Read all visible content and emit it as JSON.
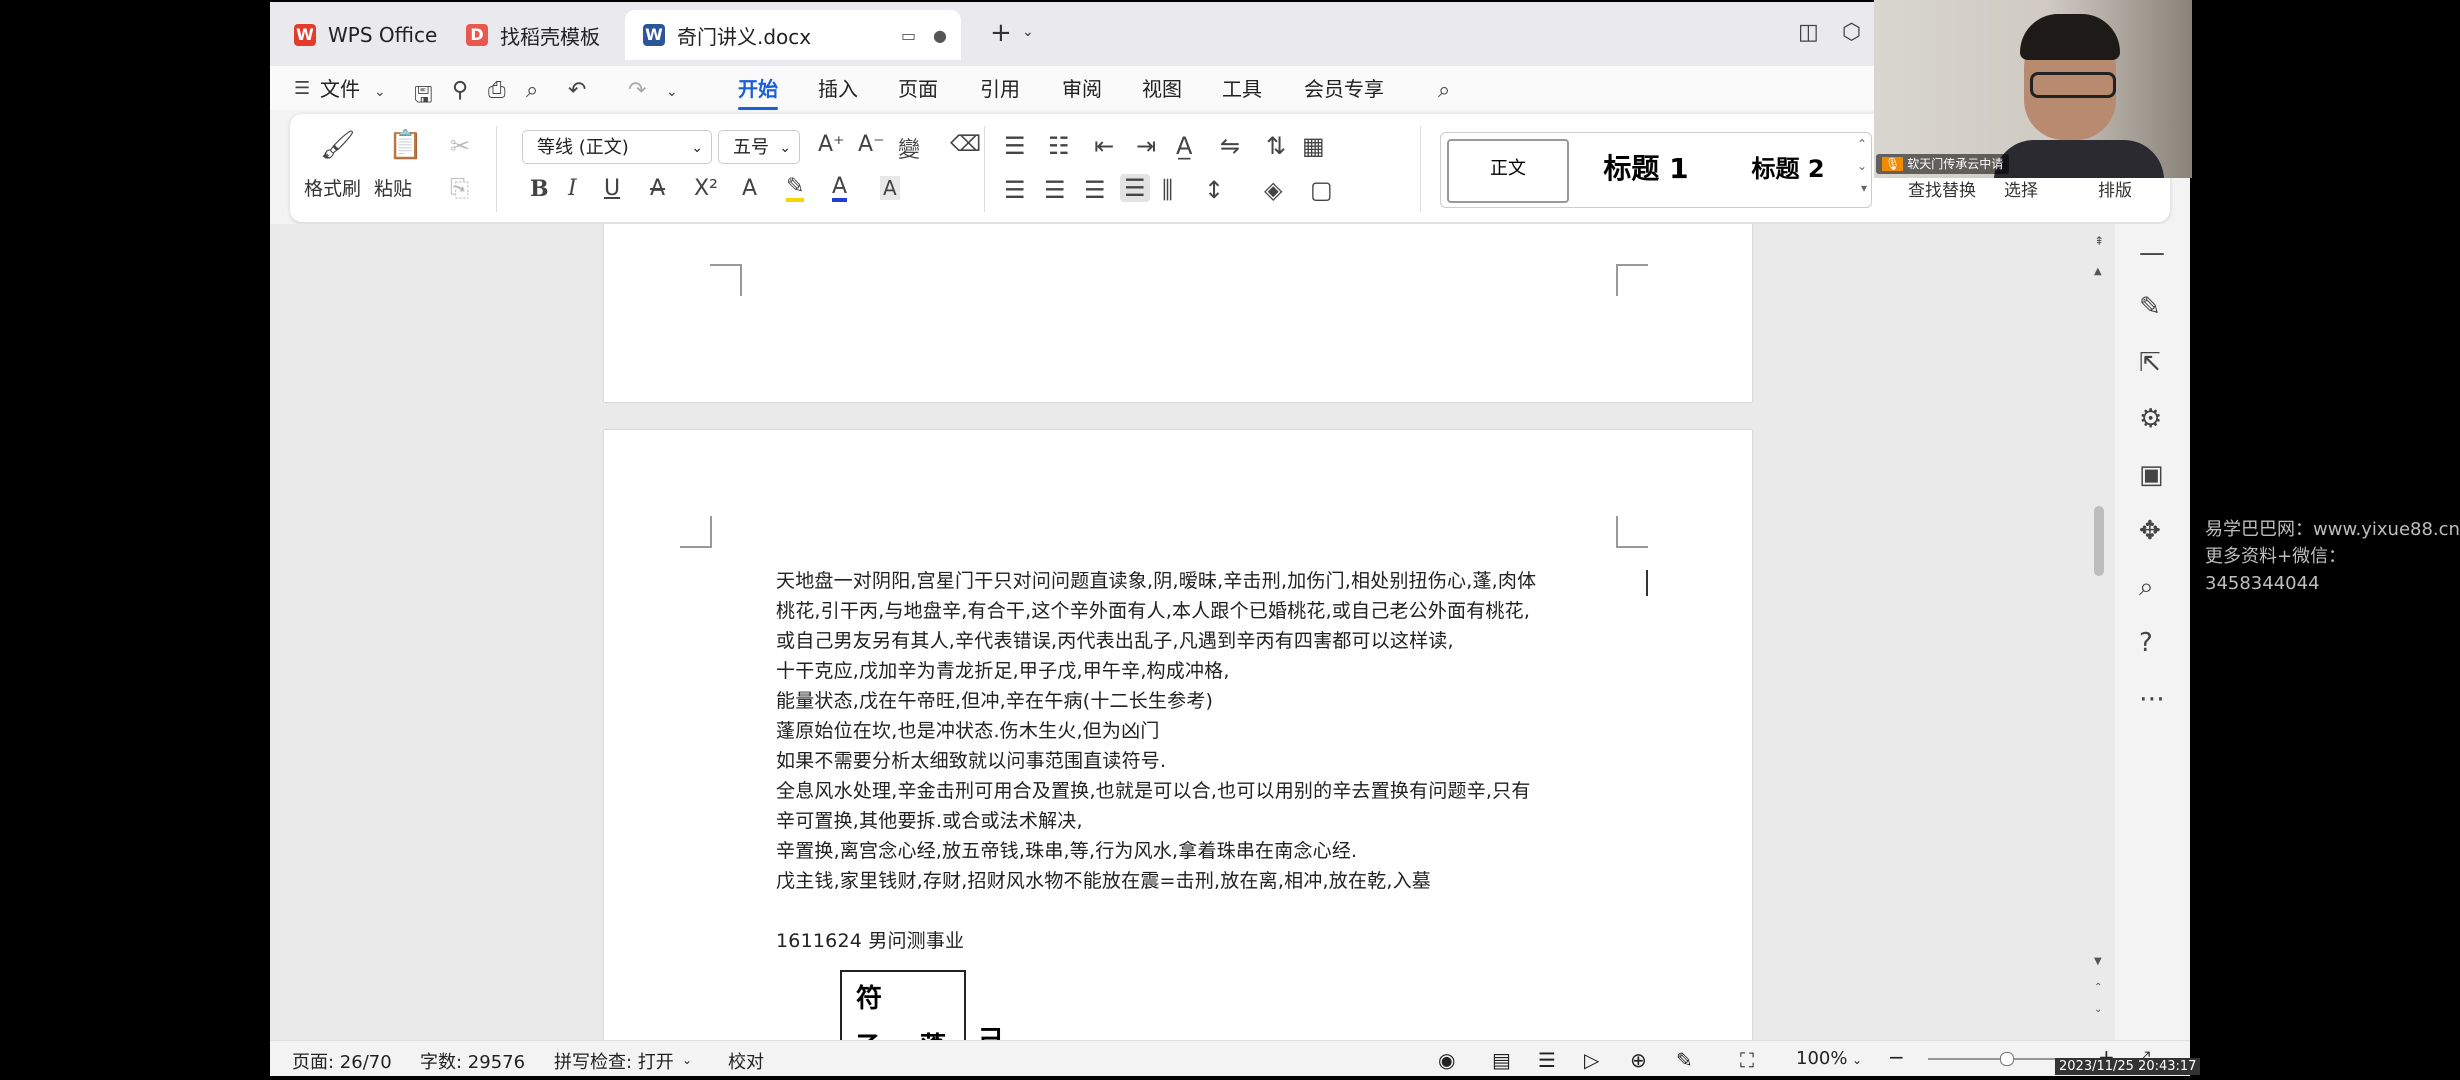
{
  "tabs": [
    {
      "label": "WPS Office",
      "icon": "wps-logo-icon"
    },
    {
      "label": "找稻壳模板",
      "icon": "docer-icon"
    },
    {
      "label": "奇门讲义.docx",
      "icon": "word-doc-icon"
    }
  ],
  "menu": {
    "file": "文件",
    "items": [
      "开始",
      "插入",
      "页面",
      "引用",
      "审阅",
      "视图",
      "工具",
      "会员专享"
    ],
    "active": "开始"
  },
  "ribbon": {
    "format_painter": "格式刷",
    "paste": "粘贴",
    "font_name": "等线 (正文)",
    "font_size": "五号",
    "styles": [
      "正文",
      "标题 1",
      "标题 2"
    ],
    "find_replace": "查找替换",
    "select": "选择",
    "arrange": "排版"
  },
  "document": {
    "lines": [
      "天地盘一对阴阳,宫星门干只对问问题直读象,阴,暧昧,辛击刑,加伤门,相处别扭伤心,蓬,肉体",
      "桃花,引干丙,与地盘辛,有合干,这个辛外面有人,本人跟个已婚桃花,或自己老公外面有桃花,",
      "或自己男友另有其人,辛代表错误,丙代表出乱子,凡遇到辛丙有四害都可以这样读,",
      "十干克应,戊加辛为青龙折足,甲子戊,甲午辛,构成冲格,",
      "能量状态,戊在午帝旺,但冲,辛在午病(十二长生参考)",
      "蓬原始位在坎,也是冲状态.伤木生火,但为凶门",
      "如果不需要分析太细致就以问事范围直读符号.",
      "全息风水处理,辛金击刑可用合及置换,也就是可以合,也可以用别的辛去置换有问题辛,只有",
      "辛可置换,其他要拆.或合或法术解决,",
      "辛置换,离宫念心经,放五帝钱,珠串,等,行为风水,拿着珠串在南念心经.",
      "戊主钱,家里钱财,存财,招财风水物不能放在震=击刑,放在离,相冲,放在乾,入墓"
    ],
    "case_title": "1611624 男问测事业",
    "box_chars": [
      "符",
      "乙",
      "蓬",
      "己"
    ]
  },
  "status": {
    "page": "页面: 26/70",
    "words": "字数: 29576",
    "spell": "拼写检查: 打开",
    "proof": "校对",
    "zoom": "100%"
  },
  "webcam": {
    "caption": "软天门传承云中请"
  },
  "watermark": {
    "line1": "易学巴巴网：www.yixue88.cn",
    "line2": "更多资料+微信：3458344044"
  },
  "timestamp": "2023/11/25 20:43:17",
  "colors": {
    "accent": "#1a5fd6",
    "wps_red": "#e13c2c",
    "word_blue": "#2b579a"
  }
}
